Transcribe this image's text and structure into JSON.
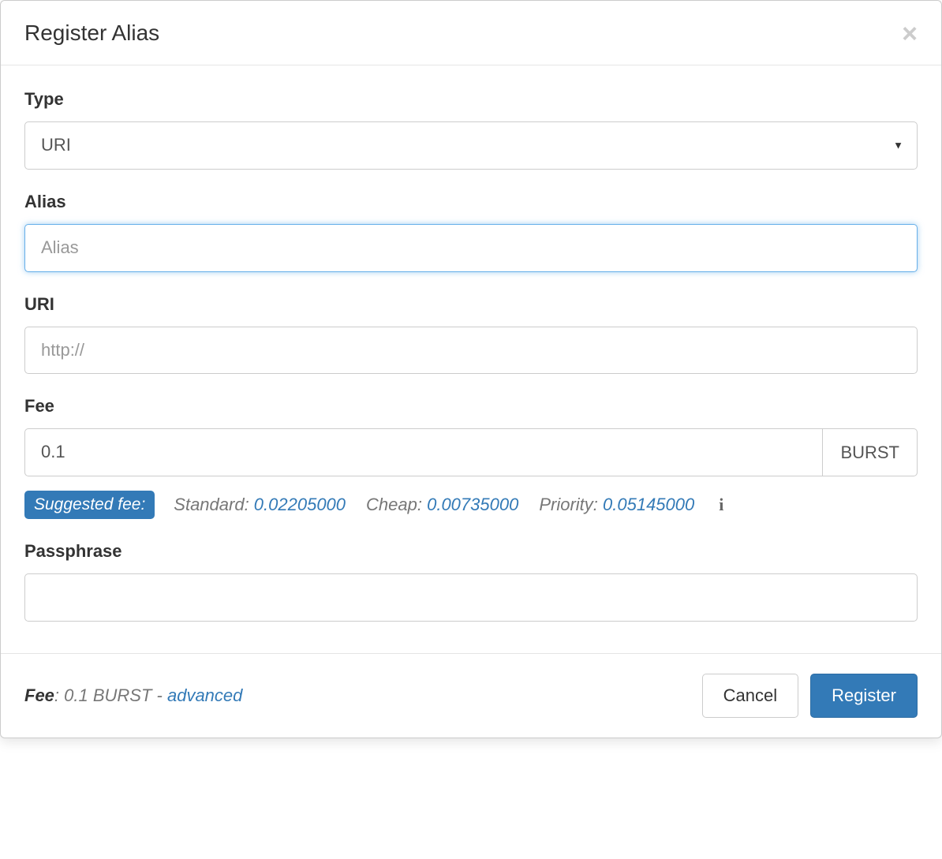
{
  "modal": {
    "title": "Register Alias"
  },
  "form": {
    "type": {
      "label": "Type",
      "value": "URI"
    },
    "alias": {
      "label": "Alias",
      "placeholder": "Alias",
      "value": ""
    },
    "uri": {
      "label": "URI",
      "placeholder": "http://",
      "value": ""
    },
    "fee": {
      "label": "Fee",
      "value": "0.1",
      "unit": "BURST"
    },
    "passphrase": {
      "label": "Passphrase",
      "value": ""
    }
  },
  "suggestedFee": {
    "badge": "Suggested fee:",
    "standard": {
      "label": "Standard: ",
      "value": "0.02205000"
    },
    "cheap": {
      "label": "Cheap: ",
      "value": "0.00735000"
    },
    "priority": {
      "label": "Priority: ",
      "value": "0.05145000"
    }
  },
  "footer": {
    "feeLabel": "Fee",
    "feeText": ": 0.1 BURST - ",
    "advancedLink": "advanced",
    "cancelButton": "Cancel",
    "registerButton": "Register"
  }
}
